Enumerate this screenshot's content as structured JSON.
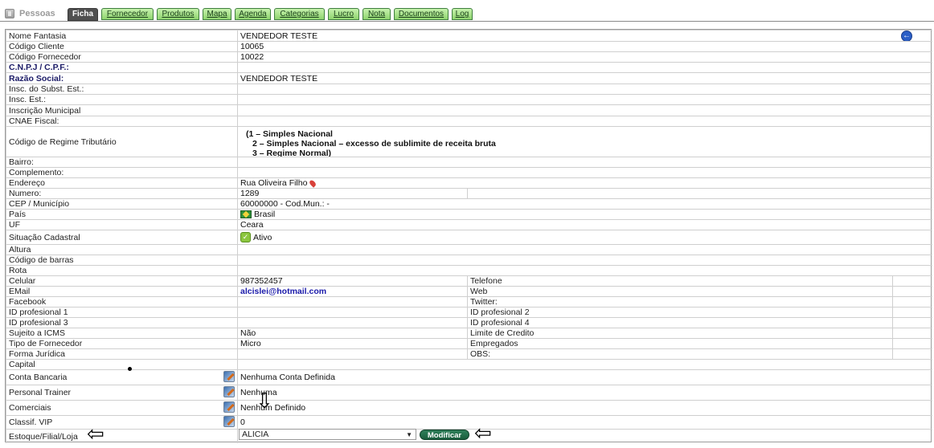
{
  "app_title": "Pessoas",
  "tabs": [
    {
      "label": "Ficha",
      "active": true
    },
    {
      "label": "Fornecedor",
      "active": false
    },
    {
      "label": "Produtos",
      "active": false
    },
    {
      "label": "Mapa",
      "active": false
    },
    {
      "label": "Agenda",
      "active": false
    },
    {
      "label": "Categorias",
      "active": false
    },
    {
      "label": "Lucro",
      "active": false
    },
    {
      "label": "Nota",
      "active": false
    },
    {
      "label": "Documentos",
      "active": false
    },
    {
      "label": "Log",
      "active": false
    }
  ],
  "fields": {
    "nome_fantasia": {
      "label": "Nome Fantasia",
      "value": "VENDEDOR TESTE"
    },
    "codigo_cliente": {
      "label": "Código Cliente",
      "value": "10065"
    },
    "codigo_fornecedor": {
      "label": "Código Fornecedor",
      "value": "10022"
    },
    "cnpj_cpf": {
      "label": "C.N.P.J / C.P.F.:",
      "value": ""
    },
    "razao_social": {
      "label": "Razão Social:",
      "value": "VENDEDOR TESTE"
    },
    "insc_subst": {
      "label": "Insc. do Subst. Est.:",
      "value": ""
    },
    "insc_est": {
      "label": "Insc. Est.:",
      "value": ""
    },
    "inscricao_municipal": {
      "label": "Inscrição Municipal",
      "value": ""
    },
    "cnae_fiscal": {
      "label": "CNAE Fiscal:",
      "value": ""
    },
    "regime": {
      "label": "Código de Regime Tributário",
      "lines": [
        "(1 – Simples Nacional",
        "2 – Simples Nacional – excesso de sublimite de receita bruta",
        "3 – Regime Normal)"
      ]
    },
    "bairro": {
      "label": "Bairro:",
      "value": ""
    },
    "complemento": {
      "label": "Complemento:",
      "value": ""
    },
    "endereco": {
      "label": "Endereço",
      "value": "Rua Oliveira Filho"
    },
    "numero": {
      "label": "Numero:",
      "value": "1289"
    },
    "cep": {
      "label": "CEP / Município",
      "value": "60000000 - Cod.Mun.: -"
    },
    "pais": {
      "label": "País",
      "value": "Brasil"
    },
    "uf": {
      "label": "UF",
      "value": "Ceara"
    },
    "situacao": {
      "label": "Situação Cadastral",
      "value": "Ativo"
    },
    "altura": {
      "label": "Altura",
      "value": ""
    },
    "codigo_barras": {
      "label": "Código de barras",
      "value": ""
    },
    "rota": {
      "label": "Rota",
      "value": ""
    },
    "celular": {
      "label": "Celular",
      "value": "987352457"
    },
    "telefone": {
      "label": "Telefone",
      "value": ""
    },
    "email": {
      "label": "EMail",
      "value": "alcislei@hotmail.com"
    },
    "web": {
      "label": "Web",
      "value": ""
    },
    "facebook": {
      "label": "Facebook",
      "value": ""
    },
    "twitter": {
      "label": "Twitter:",
      "value": ""
    },
    "id_prof_1": {
      "label": "ID profesional 1",
      "value": ""
    },
    "id_prof_2": {
      "label": "ID profesional 2",
      "value": ""
    },
    "id_prof_3": {
      "label": "ID profesional 3",
      "value": ""
    },
    "id_prof_4": {
      "label": "ID profesional 4",
      "value": ""
    },
    "sujeito_icms": {
      "label": "Sujeito a ICMS",
      "value": "Não"
    },
    "limite_credito": {
      "label": "Limite de Credito",
      "value": ""
    },
    "tipo_fornecedor": {
      "label": "Tipo de Fornecedor",
      "value": "Micro"
    },
    "empregados": {
      "label": "Empregados",
      "value": ""
    },
    "forma_juridica": {
      "label": "Forma Jurídica",
      "value": ""
    },
    "obs": {
      "label": "OBS:",
      "value": ""
    },
    "capital": {
      "label": "Capital",
      "value": ""
    },
    "conta_bancaria": {
      "label": "Conta Bancaria",
      "value": "Nenhuma Conta Definida"
    },
    "personal_trainer": {
      "label": "Personal Trainer",
      "value": "Nenhuma"
    },
    "comerciais": {
      "label": "Comerciais",
      "value": "Nenhum Definido"
    },
    "classif_vip": {
      "label": "Classif. VIP",
      "value": "0"
    },
    "estoque": {
      "label": "Estoque/Filial/Loja",
      "value": "ALICIA"
    }
  },
  "buttons": {
    "modificar": "Modificar"
  },
  "icons": {
    "back": "back-arrow-icon",
    "edit": "edit-pencil-icon",
    "map_pin": "map-pin-icon",
    "flag": "brazil-flag-icon",
    "status": "status-ok-icon"
  }
}
